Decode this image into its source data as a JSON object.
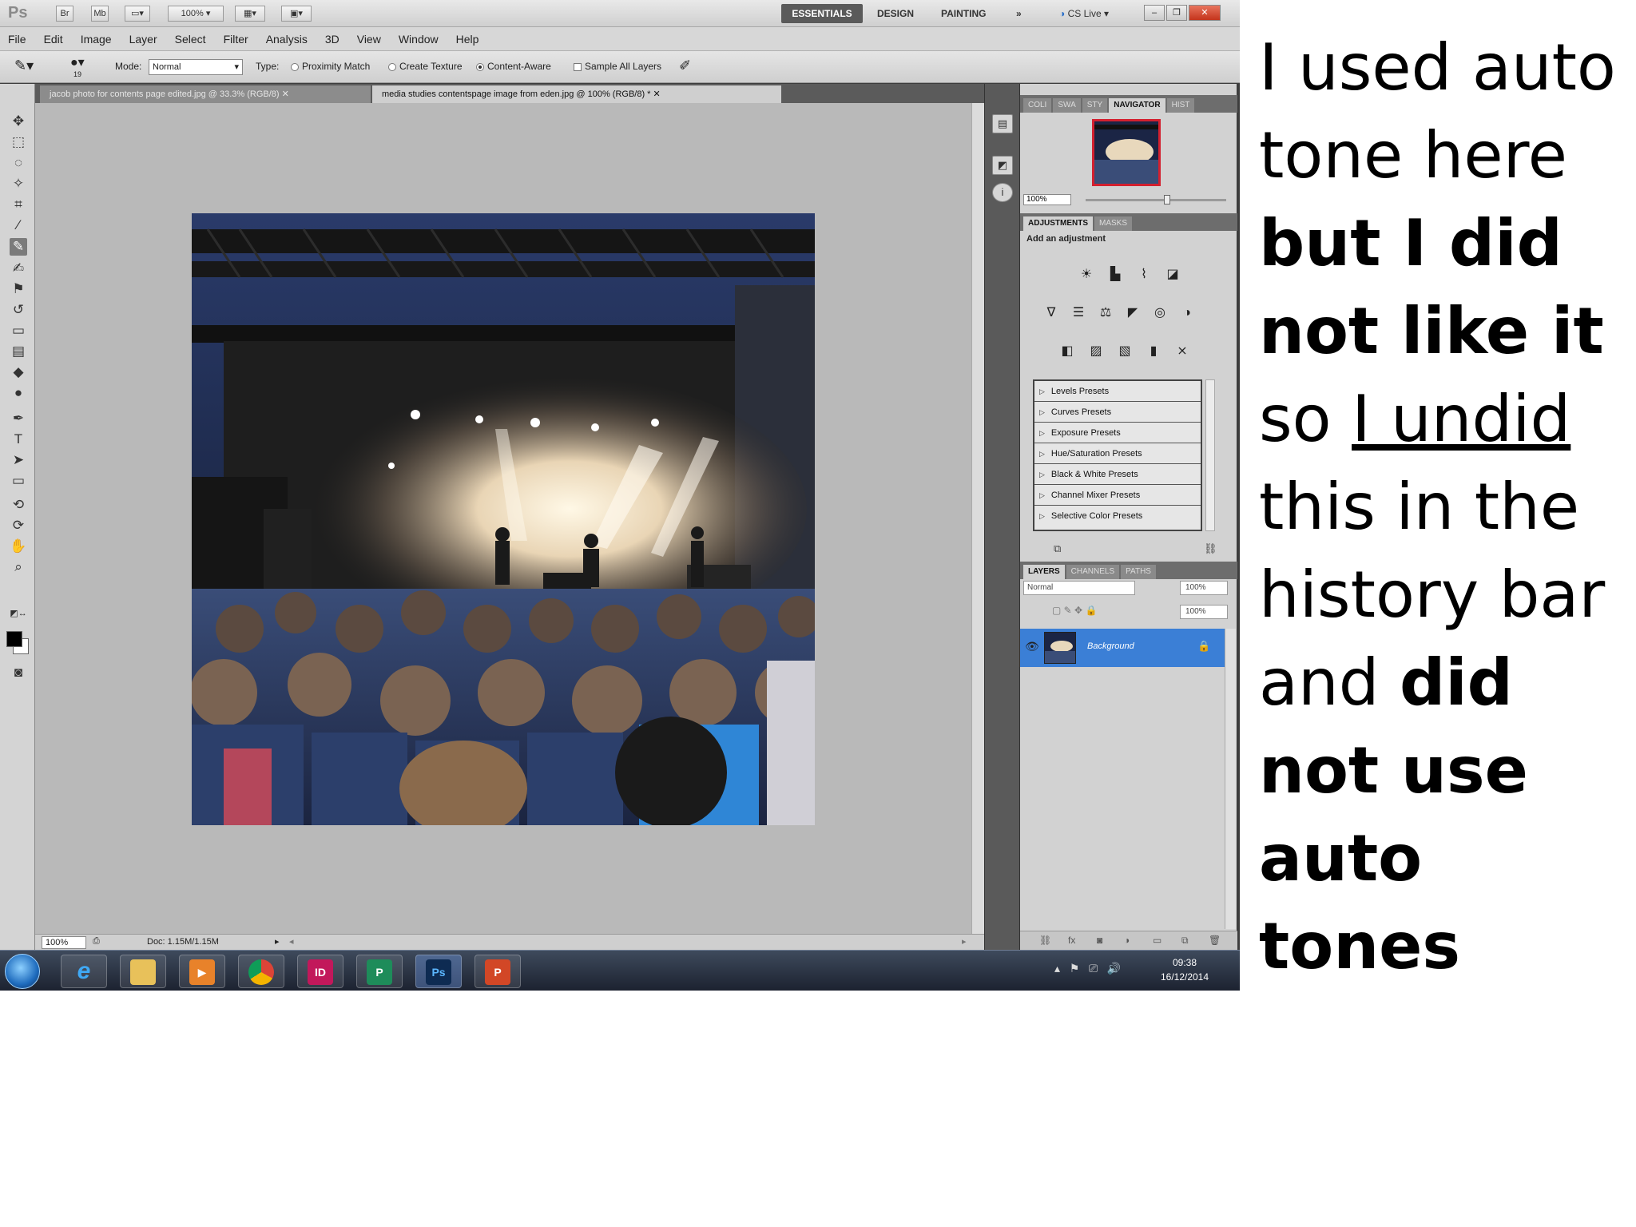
{
  "app": {
    "logo": "Ps",
    "zoom_menu": "100%",
    "workspaces": [
      "ESSENTIALS",
      "DESIGN",
      "PAINTING",
      "»"
    ],
    "cs_live": "CS Live"
  },
  "menu": [
    "File",
    "Edit",
    "Image",
    "Layer",
    "Select",
    "Filter",
    "Analysis",
    "3D",
    "View",
    "Window",
    "Help"
  ],
  "options": {
    "brush_size": "19",
    "mode_label": "Mode:",
    "mode_value": "Normal",
    "type_label": "Type:",
    "proximity": "Proximity Match",
    "create_texture": "Create Texture",
    "content_aware": "Content-Aware",
    "sample_all": "Sample All Layers"
  },
  "tabs": [
    "jacob photo for contents page edited.jpg @ 33.3% (RGB/8)",
    "media studies contentspage image from eden.jpg @ 100% (RGB/8) *"
  ],
  "status": {
    "zoom": "100%",
    "doc": "Doc: 1.15M/1.15M"
  },
  "panels": {
    "nav_tabs": [
      "COLI",
      "SWA",
      "STY",
      "NAVIGATOR",
      "HIST"
    ],
    "nav_zoom": "100%",
    "adj_tabs": [
      "ADJUSTMENTS",
      "MASKS"
    ],
    "adj_title": "Add an adjustment",
    "presets": [
      "Levels Presets",
      "Curves Presets",
      "Exposure Presets",
      "Hue/Saturation Presets",
      "Black & White Presets",
      "Channel Mixer Presets",
      "Selective Color Presets"
    ],
    "layers_tabs": [
      "LAYERS",
      "CHANNELS",
      "PATHS"
    ],
    "blend": "Normal",
    "opacity": "100%",
    "fill": "100%",
    "layer_name": "Background"
  },
  "taskbar": {
    "time": "09:38",
    "date": "16/12/2014",
    "apps": [
      "e",
      "",
      "",
      "",
      "ID",
      "P",
      "Ps",
      "P"
    ]
  },
  "annotation": {
    "p1": "I used auto tone here ",
    "p2": "but I did not like it",
    "p3": " so ",
    "p4": "I undid ",
    "p5": "this in the history bar and ",
    "p6": "did not use auto tones"
  },
  "colors": {
    "accent_selected_layer": "#3b7fd6",
    "close_button": "#c4341c",
    "navigator_frame": "#d3202f"
  }
}
